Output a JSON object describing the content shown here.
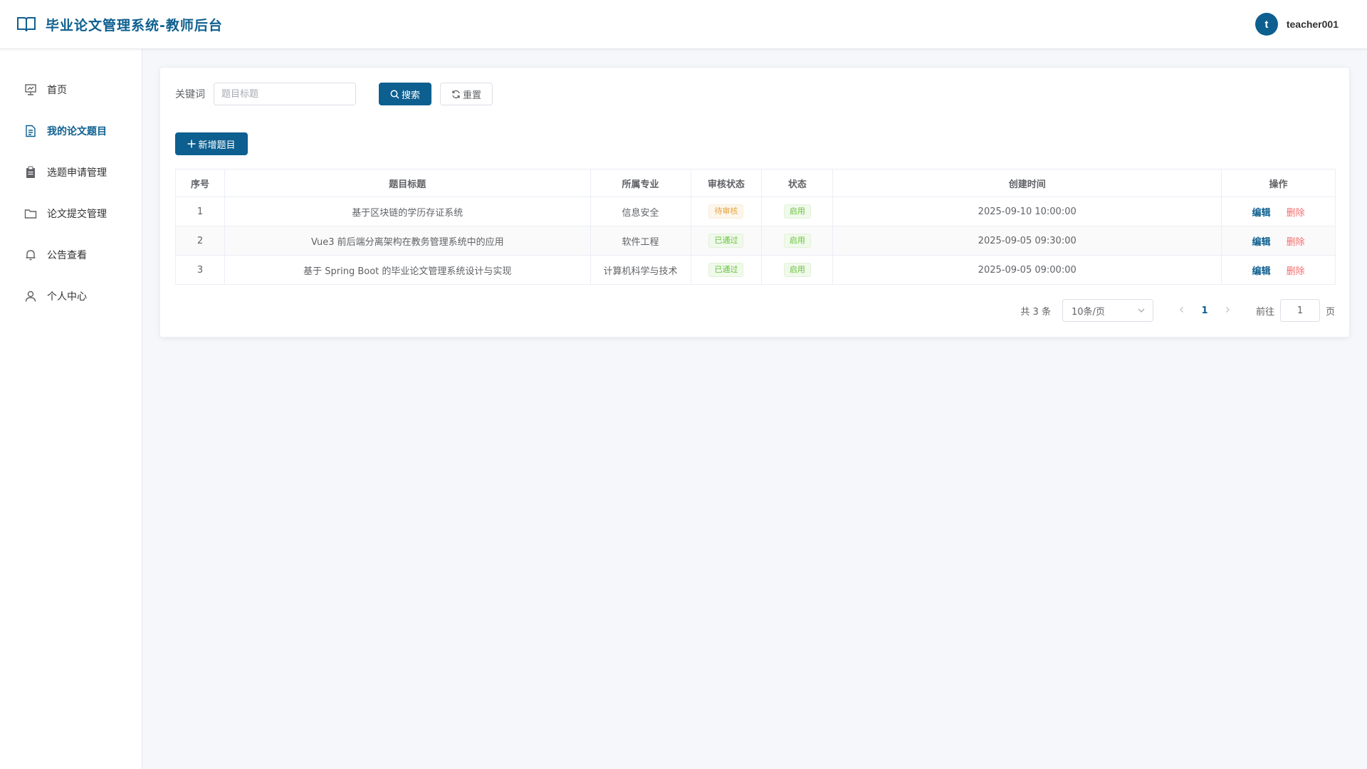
{
  "header": {
    "title": "毕业论文管理系统-教师后台",
    "user": {
      "avatar_letter": "t",
      "name": "teacher001"
    }
  },
  "colors": {
    "primary": "#0d5f8f",
    "danger": "#f56c6c",
    "warning": "#e6a23c",
    "success": "#67c23a"
  },
  "sidebar": {
    "items": [
      {
        "label": "首页",
        "icon": "dashboard-icon",
        "active": false
      },
      {
        "label": "我的论文题目",
        "icon": "document-icon",
        "active": true
      },
      {
        "label": "选题申请管理",
        "icon": "clipboard-icon",
        "active": false
      },
      {
        "label": "论文提交管理",
        "icon": "folder-icon",
        "active": false
      },
      {
        "label": "公告查看",
        "icon": "bell-icon",
        "active": false
      },
      {
        "label": "个人中心",
        "icon": "user-icon",
        "active": false
      }
    ]
  },
  "search": {
    "keyword_label": "关键词",
    "placeholder": "题目标题",
    "value": "",
    "search_label": "搜索",
    "reset_label": "重置"
  },
  "actions": {
    "add_label": "新增题目"
  },
  "table": {
    "columns": [
      "序号",
      "题目标题",
      "所属专业",
      "审核状态",
      "状态",
      "创建时间",
      "操作"
    ],
    "rows": [
      {
        "index": "1",
        "title": "基于区块链的学历存证系统",
        "major": "信息安全",
        "review": "待审核",
        "review_type": "warning",
        "status": "启用",
        "created": "2025-09-10 10:00:00"
      },
      {
        "index": "2",
        "title": "Vue3 前后端分离架构在教务管理系统中的应用",
        "major": "软件工程",
        "review": "已通过",
        "review_type": "success",
        "status": "启用",
        "created": "2025-09-05 09:30:00"
      },
      {
        "index": "3",
        "title": "基于 Spring Boot 的毕业论文管理系统设计与实现",
        "major": "计算机科学与技术",
        "review": "已通过",
        "review_type": "success",
        "status": "启用",
        "created": "2025-09-05 09:00:00"
      }
    ],
    "edit_label": "编辑",
    "delete_label": "删除"
  },
  "pagination": {
    "total_text": "共 3 条",
    "page_size": "10条/页",
    "current_page": "1",
    "goto_label": "前往",
    "goto_value": "1",
    "page_suffix": "页"
  }
}
